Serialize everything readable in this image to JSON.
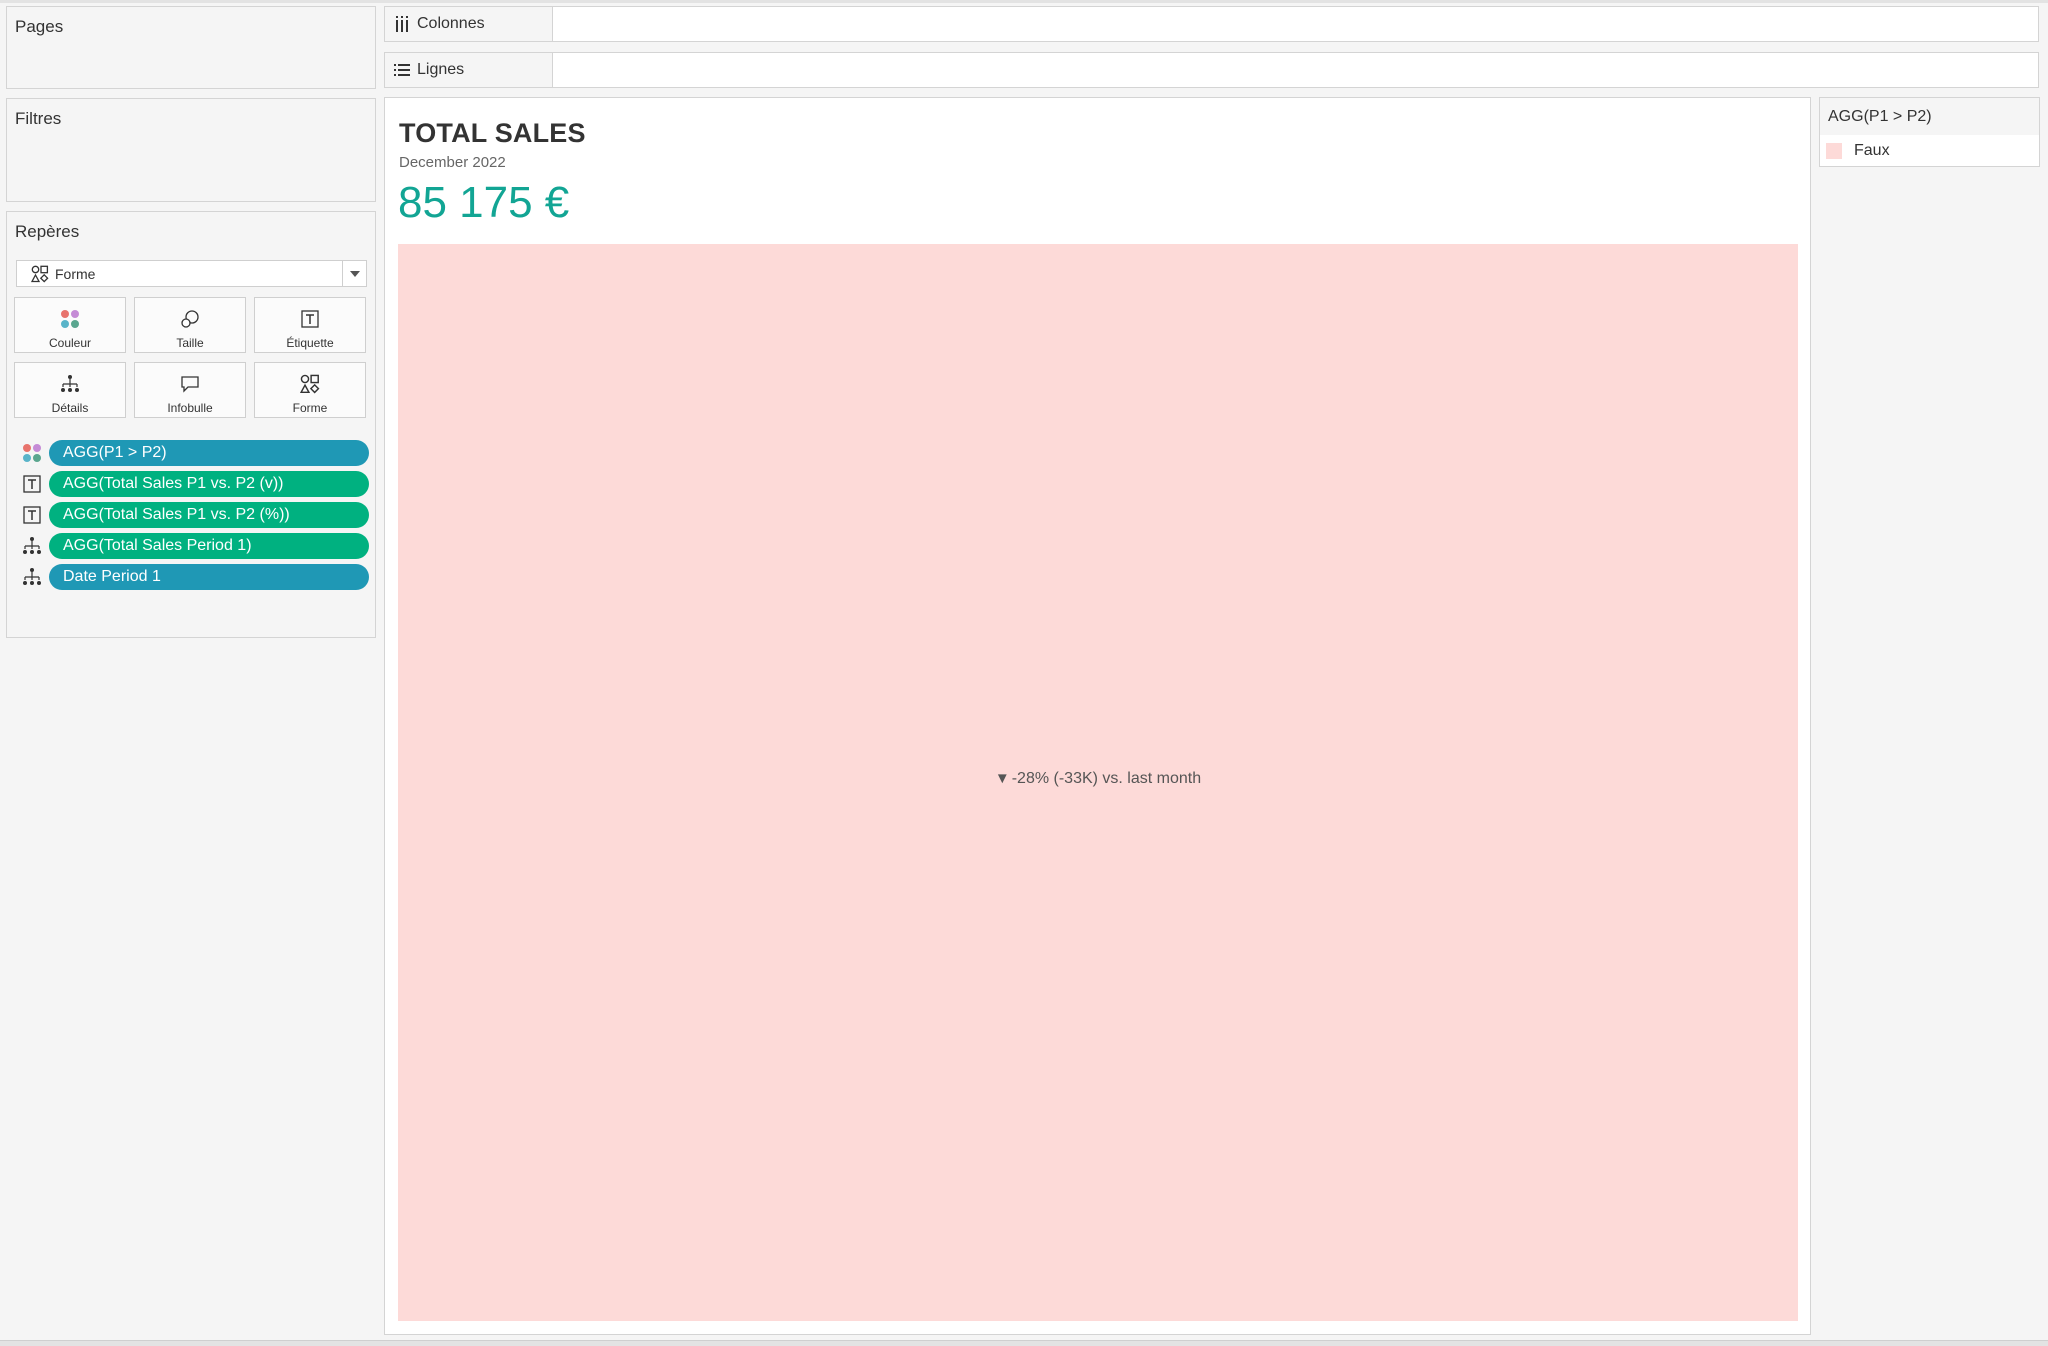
{
  "cards": {
    "pages_title": "Pages",
    "filters_title": "Filtres",
    "marks_title": "Repères"
  },
  "marks": {
    "mark_type": "Forme",
    "buttons": [
      {
        "label": "Couleur",
        "icon": "color-icon"
      },
      {
        "label": "Taille",
        "icon": "size-icon"
      },
      {
        "label": "Étiquette",
        "icon": "label-icon"
      },
      {
        "label": "Détails",
        "icon": "detail-icon"
      },
      {
        "label": "Infobulle",
        "icon": "tooltip-icon"
      },
      {
        "label": "Forme",
        "icon": "shape-icon"
      }
    ],
    "pills": [
      {
        "label": "AGG(P1 > P2)",
        "icon": "color-icon",
        "color": "#1f98b5"
      },
      {
        "label": "AGG(Total Sales P1 vs. P2 (v))",
        "icon": "label-icon",
        "color": "#00b180"
      },
      {
        "label": "AGG(Total Sales P1 vs. P2 (%))",
        "icon": "label-icon",
        "color": "#00b180"
      },
      {
        "label": "AGG(Total Sales Period 1)",
        "icon": "detail-icon",
        "color": "#00b180"
      },
      {
        "label": "Date Period 1",
        "icon": "detail-icon",
        "color": "#1f98b5"
      }
    ]
  },
  "shelves": {
    "columns_label": "Colonnes",
    "rows_label": "Lignes"
  },
  "viz": {
    "title": "TOTAL SALES",
    "subtitle": "December 2022",
    "kpi": "85 175 €",
    "kpi_color": "#12a594",
    "mark_color": "#fddad8",
    "mark_label_arrow": "▼",
    "mark_label": "-28% (-33K) vs. last month"
  },
  "legend": {
    "title": "AGG(P1 > P2)",
    "items": [
      {
        "label": "Faux",
        "color": "#fddad8"
      }
    ]
  }
}
